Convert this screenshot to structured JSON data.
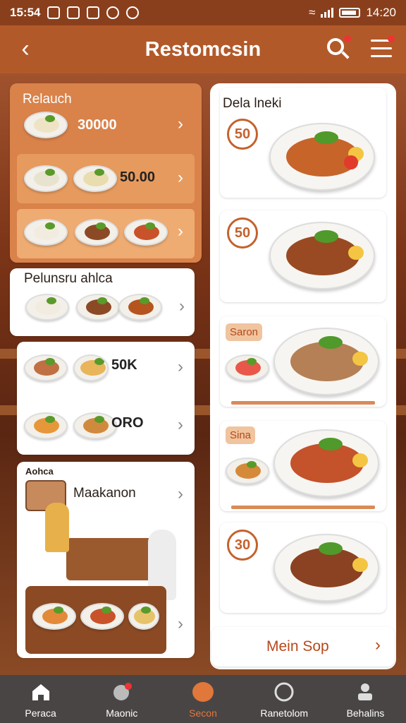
{
  "status_bar": {
    "time": "15:54",
    "clock_right": "14:20"
  },
  "header": {
    "title": "Restomcsin",
    "back_icon": "chevron-left-icon",
    "search_icon": "search-icon",
    "menu_icon": "menu-icon"
  },
  "left": {
    "card1": {
      "title": "Relauch",
      "price": "30000",
      "row2_price": "50.00"
    },
    "card2": {
      "title": "Pelunsru ahlca"
    },
    "card3": {
      "price1": "50K",
      "price2": "ORO"
    },
    "card4": {
      "title": "Aohca",
      "subtitle": "Maakanon"
    }
  },
  "right": {
    "title": "Dela lneki",
    "items": [
      {
        "badge": "50"
      },
      {
        "badge": "50"
      },
      {
        "tag": "Saron"
      },
      {
        "tag": "Sina"
      },
      {
        "badge": "30"
      }
    ],
    "footer": "Mein Sop"
  },
  "nav": [
    {
      "label": "Peraca",
      "icon": "home-icon"
    },
    {
      "label": "Maonic",
      "icon": "leaf-icon"
    },
    {
      "label": "Secon",
      "icon": "plate-icon"
    },
    {
      "label": "Ranetolom",
      "icon": "receipt-icon"
    },
    {
      "label": "Behalins",
      "icon": "profile-icon"
    }
  ],
  "colors": {
    "accent": "#c4622d",
    "header": "#b2592a",
    "nav_bg": "#4a4545",
    "active": "#e0773b"
  }
}
